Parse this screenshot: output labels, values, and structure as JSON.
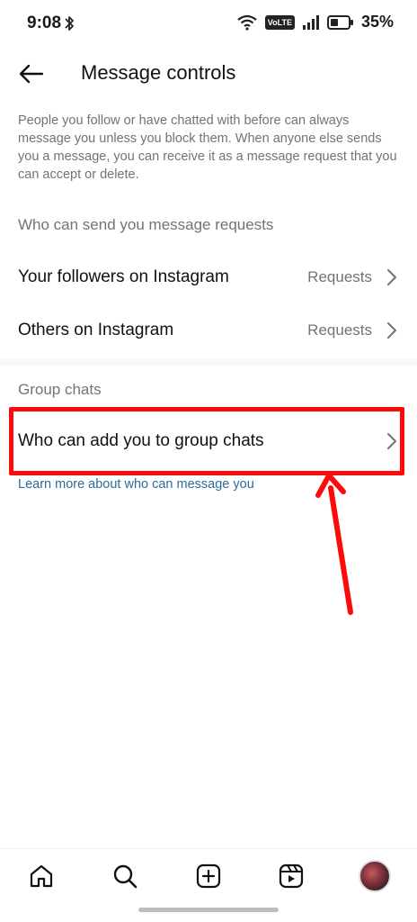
{
  "status_bar": {
    "time": "9:08",
    "network_badge": "VoLTE",
    "battery_percent": "35%",
    "icons": [
      "bluetooth-icon",
      "wifi-icon",
      "signal-icon",
      "battery-icon"
    ]
  },
  "header": {
    "title": "Message controls",
    "back_icon": "arrow-left-icon"
  },
  "description": "People you follow or have chatted with before can always message you unless you block them. When anyone else sends you a message, you can receive it as a message request that you can accept or delete.",
  "message_requests": {
    "section_label": "Who can send you message requests",
    "rows": [
      {
        "label": "Your followers on Instagram",
        "value": "Requests"
      },
      {
        "label": "Others on Instagram",
        "value": "Requests"
      }
    ]
  },
  "group_chats": {
    "section_label": "Group chats",
    "rows": [
      {
        "label": "Who can add you to group chats"
      }
    ]
  },
  "learn_more_link": "Learn more about who can message you",
  "annotation": {
    "color": "#ff0a0a"
  },
  "bottom_nav": {
    "items": [
      "home-icon",
      "search-icon",
      "create-icon",
      "reels-icon",
      "profile-avatar"
    ]
  }
}
